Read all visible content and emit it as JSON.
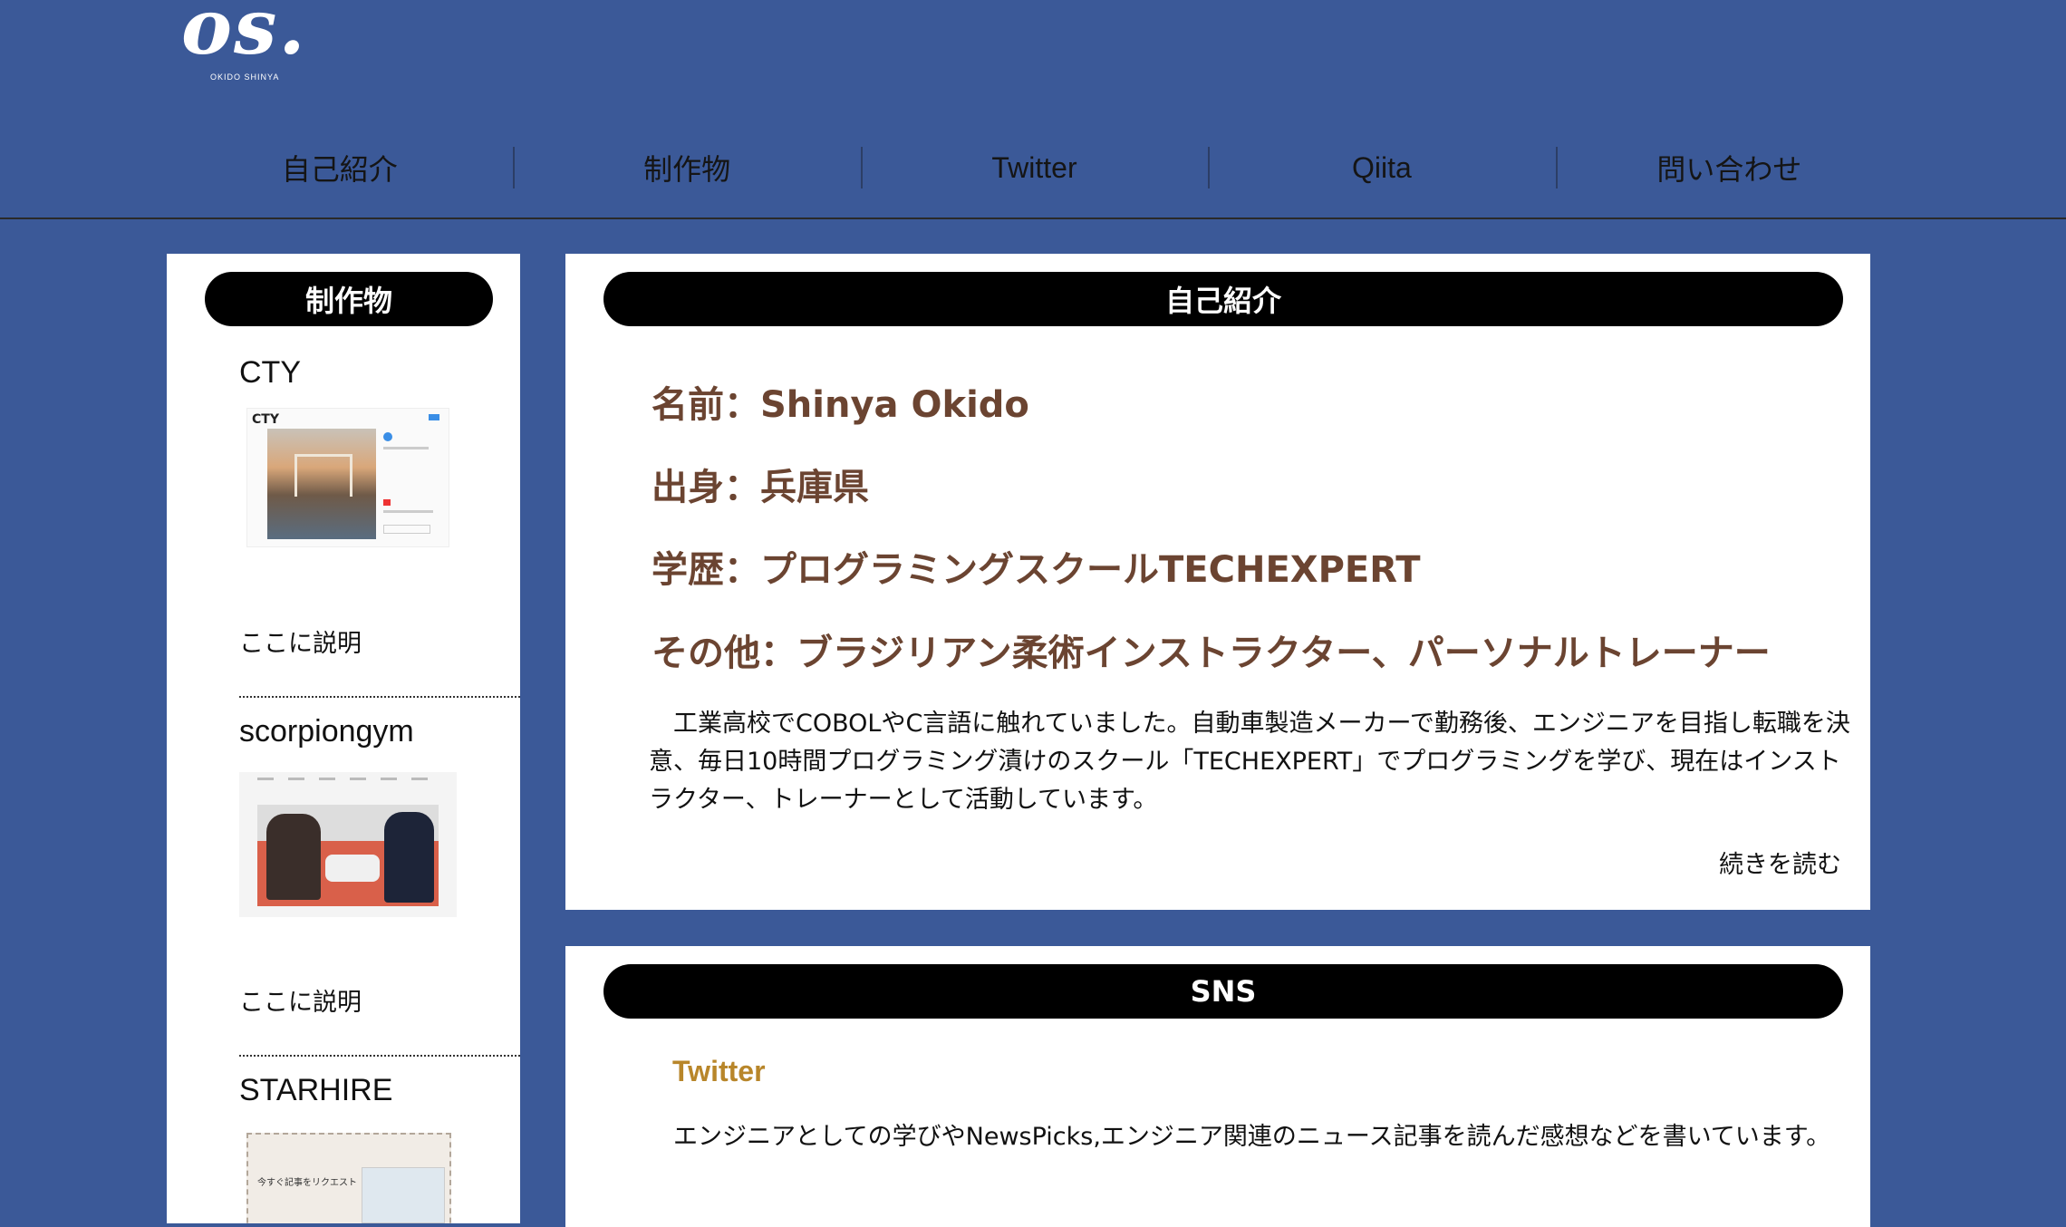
{
  "header": {
    "logo": "os.",
    "logo_sub": "OKIDO SHINYA",
    "nav": [
      "自己紹介",
      "制作物",
      "Twitter",
      "Qiita",
      "問い合わせ"
    ]
  },
  "works": {
    "heading": "制作物",
    "items": [
      {
        "title": "CTY",
        "thumb_label": "CTY",
        "desc": "ここに説明"
      },
      {
        "title": "scorpiongym",
        "desc": "ここに説明"
      },
      {
        "title": "STARHIRE",
        "thumb_text": "今すぐ記事をリクエスト"
      }
    ]
  },
  "about": {
    "heading": "自己紹介",
    "name": "名前：Shinya Okido",
    "origin": "出身：兵庫県",
    "education": "学歴：プログラミングスクールTECHEXPERT",
    "other": "その他：ブラジリアン柔術インストラクター、パーソナルトレーナー",
    "body": "工業高校でCOBOLやC言語に触れていました。自動車製造メーカーで勤務後、エンジニアを目指し転職を決意、毎日10時間プログラミング漬けのスクール「TECHEXPERT」でプログラミングを学び、現在はインストラクター、トレーナーとして活動しています。",
    "read_more": "続きを読む"
  },
  "sns": {
    "heading": "SNS",
    "twitter_label": "Twitter",
    "twitter_body": "エンジニアとしての学びやNewsPicks,エンジニア関連のニュース記事を読んだ感想などを書いています。"
  },
  "colors": {
    "background": "#3b5998",
    "heading_brown": "#6b4431",
    "twitter_gold": "#b8862a"
  }
}
